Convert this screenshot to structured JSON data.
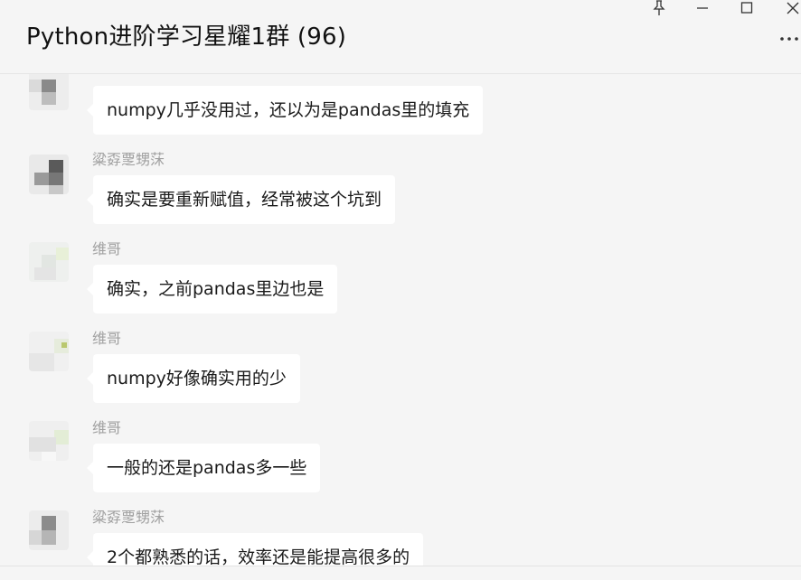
{
  "window": {
    "title": "Python进阶学习星耀1群 (96)",
    "pin_icon": "pin-icon",
    "minimize_icon": "minimize-icon",
    "maximize_icon": "maximize-icon",
    "close_icon": "close-icon",
    "more_icon": "more-icon"
  },
  "messages": [
    {
      "sender": "",
      "text": "numpy几乎没用过，还以为是pandas里的填充"
    },
    {
      "sender": "粱孬覂甥莯",
      "text": "确实是要重新赋值，经常被这个坑到"
    },
    {
      "sender": "维哥",
      "text": "确实，之前pandas里边也是"
    },
    {
      "sender": "维哥",
      "text": "numpy好像确实用的少"
    },
    {
      "sender": "维哥",
      "text": "一般的还是pandas多一些"
    },
    {
      "sender": "粱孬覂甥莯",
      "text": "2个都熟悉的话，效率还是能提高很多的"
    }
  ],
  "colors": {
    "background": "#f5f5f5",
    "bubble": "#ffffff",
    "sender_text": "#a0a0a0"
  }
}
